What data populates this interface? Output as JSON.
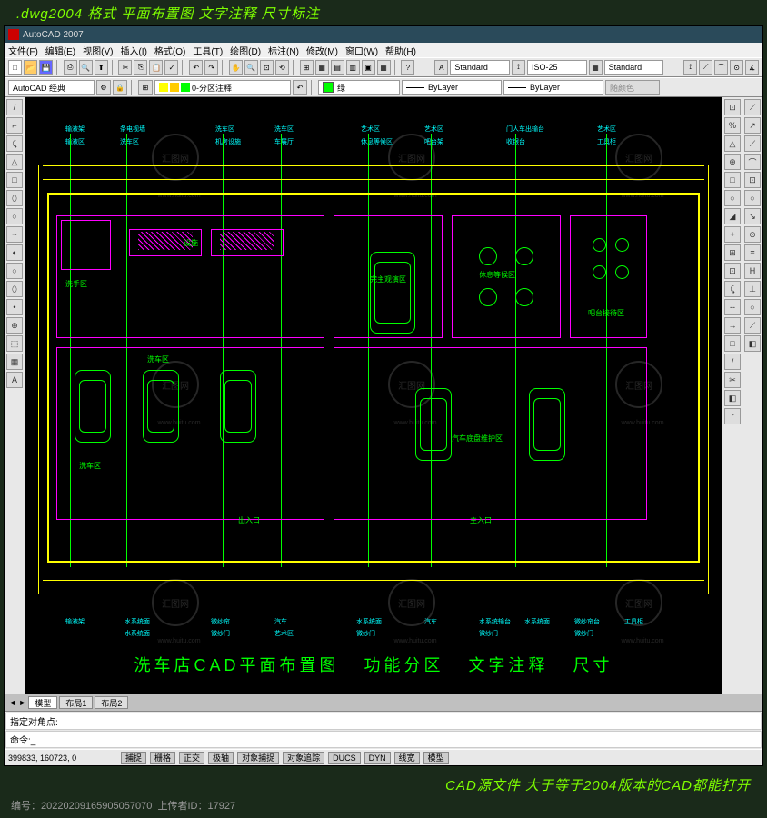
{
  "top_banner": ".dwg2004 格式  平面布置图 文字注释 尺寸标注",
  "app_title": "AutoCAD 2007",
  "menubar": [
    "文件(F)",
    "编辑(E)",
    "视图(V)",
    "插入(I)",
    "格式(O)",
    "工具(T)",
    "绘图(D)",
    "标注(N)",
    "修改(M)",
    "窗口(W)",
    "帮助(H)"
  ],
  "toolbar2": {
    "workspace": "AutoCAD 经典",
    "layer": "0-分区注释",
    "color": "绿",
    "linetype": "ByLayer",
    "lineweight": "ByLayer",
    "plot_style": "随颜色"
  },
  "toolbar1_styles": {
    "text_style": "Standard",
    "dim_style": "ISO-25",
    "table_style": "Standard"
  },
  "left_tool_icons": [
    "/",
    "⌐",
    "⤹",
    "△",
    "□",
    "⬯",
    "○",
    "~",
    "◐",
    "○",
    "⬯",
    "•",
    "⊕",
    "⬚",
    "▦",
    "A"
  ],
  "right_tool_icons_a": [
    "⊡",
    "%",
    "△",
    "⊕",
    "□",
    "○",
    "◢",
    "+",
    "⊞",
    "⊡",
    "⤹",
    "--",
    "→",
    "□",
    "/",
    "✂",
    "◧",
    "r"
  ],
  "right_tool_icons_b": [
    "⟋",
    "↗",
    "⟋",
    "⌒",
    "⊡",
    "○",
    "↘",
    "⊙",
    "≡",
    "H",
    "⊥",
    "○",
    "⟋",
    "◧"
  ],
  "drawing": {
    "top_labels": [
      "输液架",
      "输液区",
      "条电视墙",
      "洗车区",
      "洗车区",
      "机房设施",
      "洗车区",
      "车展厅",
      "艺术区",
      "休息等候区",
      "艺术区",
      "吧台架",
      "门人车出输台",
      "收银台",
      "艺术区",
      "工具柜"
    ],
    "bottom_labels_row1": [
      "输液架",
      "水系统面",
      "微纱帘",
      "汽车",
      "水系统面",
      "汽车",
      "水系统输台",
      "水系统面",
      "微纱帘台",
      "工具柜"
    ],
    "bottom_labels_row2": [
      "水系统面",
      "微纱门",
      "艺术区",
      "微纱门",
      "微纱门",
      "微纱门"
    ],
    "room_labels": {
      "xiche": "洗车区",
      "sheshi": "设施",
      "wanzhu": "完主观演区",
      "xiuche": "休息等候区",
      "qiche_weihu": "汽车底盘维护区",
      "batai": "吧台接待区",
      "churu1": "出入口",
      "churu2": "主入口",
      "xiushou": "洗手区"
    },
    "bottom_title_parts": [
      "洗车店CAD平面布置图",
      "功能分区",
      "文字注释",
      "尺寸"
    ]
  },
  "tabs": {
    "arrows": "◄ ►",
    "items": [
      "模型",
      "布局1",
      "布局2"
    ]
  },
  "command": {
    "line1": "指定对角点:",
    "line2": "命令:",
    "extra": "_"
  },
  "statusbar": {
    "coords": "399833, 160723, 0",
    "buttons": [
      "捕捉",
      "栅格",
      "正交",
      "极轴",
      "对象捕捉",
      "对象追踪",
      "DUCS",
      "DYN",
      "线宽",
      "模型"
    ]
  },
  "bottom_banner": "CAD源文件  大于等于2004版本的CAD都能打开",
  "footer": {
    "id_label": "编号：",
    "id": "20220209165905057070",
    "uploader_label": "上传者ID：",
    "uploader": "17927"
  },
  "watermark": {
    "text": "汇图网",
    "url": "www.huitu.com"
  }
}
